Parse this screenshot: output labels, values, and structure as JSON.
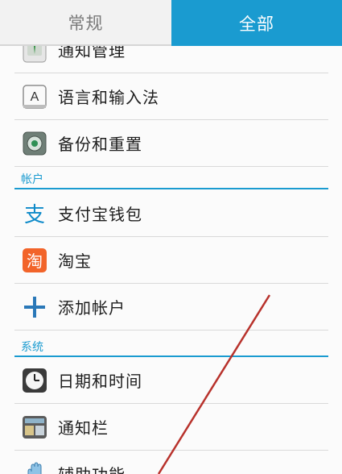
{
  "tabs": {
    "general": "常规",
    "all": "全部"
  },
  "items": {
    "notification_mgmt": "通知管理",
    "language": "语言和输入法",
    "backup": "备份和重置",
    "alipay": "支付宝钱包",
    "taobao": "淘宝",
    "add_account": "添加帐户",
    "datetime": "日期和时间",
    "notif_bar": "通知栏",
    "accessibility": "辅助功能"
  },
  "sections": {
    "accounts": "帐户",
    "system": "系统"
  },
  "icons": {
    "language_glyph": "A",
    "alipay_glyph": "支",
    "taobao_glyph": "淘",
    "add_glyph": "+"
  },
  "colors": {
    "accent": "#1a9bd0",
    "annotation_line": "#b8322c"
  }
}
